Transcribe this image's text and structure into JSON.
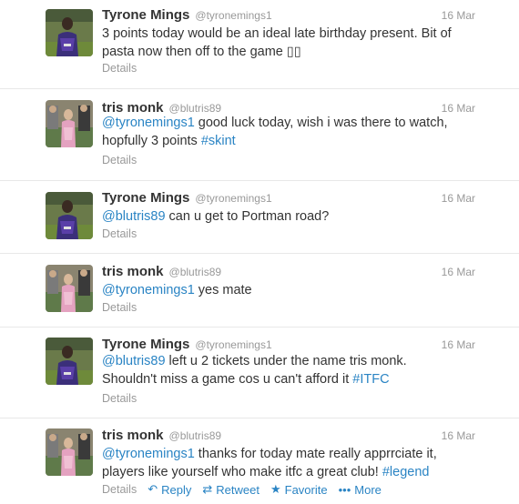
{
  "tweets": [
    {
      "name": "Tyrone Mings",
      "handle": "@tyronemings1",
      "time": "16 Mar",
      "lines": [
        [
          {
            "t": "3 points today would be an ideal late birthday present. Bit of",
            "link": false
          }
        ],
        [
          {
            "t": "pasta now then off to the game ",
            "link": false
          },
          {
            "t": "▯▯",
            "link": false
          }
        ]
      ],
      "details": "Details",
      "avatar": "tyrone"
    },
    {
      "name": "tris monk",
      "handle": "@blutris89",
      "time": "16 Mar",
      "lines": [
        [
          {
            "t": "@tyronemings1",
            "link": true
          },
          {
            "t": " good luck today, wish i was there to watch,",
            "link": false
          }
        ],
        [
          {
            "t": "hopfully 3 points ",
            "link": false
          },
          {
            "t": "#skint",
            "link": true
          }
        ]
      ],
      "details": "Details",
      "avatar": "tris"
    },
    {
      "name": "Tyrone Mings",
      "handle": "@tyronemings1",
      "time": "16 Mar",
      "lines": [
        [
          {
            "t": "@blutris89",
            "link": true
          },
          {
            "t": " can u get to Portman road?",
            "link": false
          }
        ]
      ],
      "details": "Details",
      "avatar": "tyrone"
    },
    {
      "name": "tris monk",
      "handle": "@blutris89",
      "time": "16 Mar",
      "lines": [
        [
          {
            "t": "@tyronemings1",
            "link": true
          },
          {
            "t": " yes mate",
            "link": false
          }
        ]
      ],
      "details": "Details",
      "avatar": "tris"
    },
    {
      "name": "Tyrone Mings",
      "handle": "@tyronemings1",
      "time": "16 Mar",
      "lines": [
        [
          {
            "t": "@blutris89",
            "link": true
          },
          {
            "t": " left u 2 tickets under the name tris monk.",
            "link": false
          }
        ],
        [
          {
            "t": "Shouldn't miss a game cos u can't afford it ",
            "link": false
          },
          {
            "t": "#ITFC",
            "link": true
          }
        ]
      ],
      "details": "Details",
      "avatar": "tyrone"
    },
    {
      "name": "tris monk",
      "handle": "@blutris89",
      "time": "16 Mar",
      "lines": [
        [
          {
            "t": "@tyronemings1",
            "link": true
          },
          {
            "t": " thanks for today mate really apprrciate it,",
            "link": false
          }
        ],
        [
          {
            "t": "players like yourself who make itfc a great club! ",
            "link": false
          },
          {
            "t": "#legend",
            "link": true
          }
        ]
      ],
      "details": "Details",
      "avatar": "tris",
      "actions": [
        {
          "label": "Reply",
          "icon": "reply-icon",
          "glyph": "↶"
        },
        {
          "label": "Retweet",
          "icon": "retweet-icon",
          "glyph": "⇄"
        },
        {
          "label": "Favorite",
          "icon": "star-icon",
          "glyph": "★"
        },
        {
          "label": "More",
          "icon": "more-icon",
          "glyph": "•••"
        }
      ]
    }
  ],
  "colors": {
    "link": "#2a84c4",
    "muted": "#999999",
    "text": "#333333",
    "divider": "#e8e8e8"
  }
}
